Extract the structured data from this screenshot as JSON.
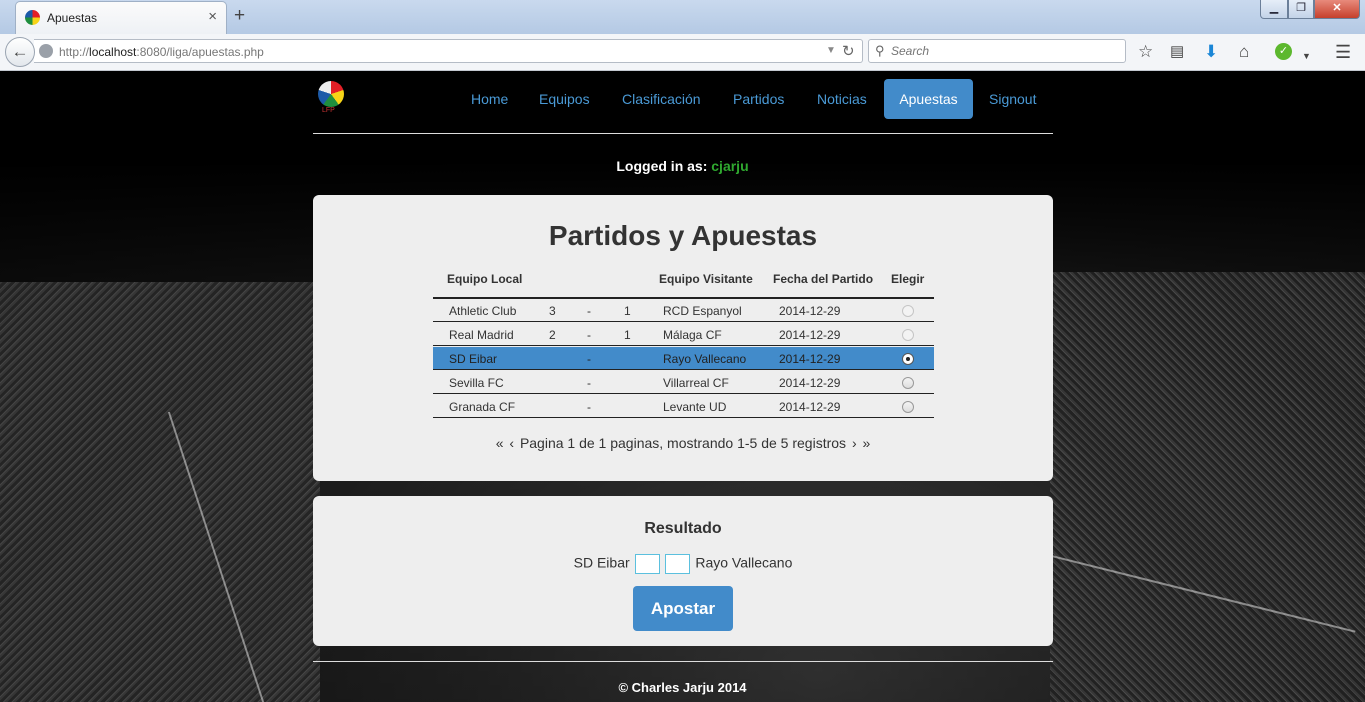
{
  "browser": {
    "tab_title": "Apuestas",
    "tab_close": "×",
    "new_tab": "+",
    "url_prefix": "http://",
    "url_host": "localhost",
    "url_rest": ":8080/liga/apuestas.php",
    "search_placeholder": "Search",
    "window_buttons": {
      "min": "▁",
      "max": "❐",
      "close": "✕"
    },
    "icons": [
      "bookmark-star-icon",
      "reading-list-icon",
      "download-icon",
      "home-icon",
      "addon-check-icon",
      "menu-icon"
    ]
  },
  "site": {
    "logo_text": "LFP",
    "nav": [
      {
        "label": "Home",
        "active": false
      },
      {
        "label": "Equipos",
        "active": false
      },
      {
        "label": "Clasificación",
        "active": false
      },
      {
        "label": "Partidos",
        "active": false
      },
      {
        "label": "Noticias",
        "active": false
      },
      {
        "label": "Apuestas",
        "active": true
      },
      {
        "label": "Signout",
        "active": false
      }
    ],
    "logged_in_label": "Logged in as:",
    "username": "cjarju"
  },
  "matches": {
    "title": "Partidos y Apuestas",
    "headers": [
      "Equipo Local",
      "Equipo Visitante",
      "Fecha del Partido",
      "Elegir"
    ],
    "rows": [
      {
        "local": "Athletic Club",
        "local_goals": "3",
        "sep": "-",
        "away_goals": "1",
        "away": "RCD Espanyol",
        "date": "2014-12-29",
        "selected": false,
        "disabled": true
      },
      {
        "local": "Real Madrid",
        "local_goals": "2",
        "sep": "-",
        "away_goals": "1",
        "away": "Málaga CF",
        "date": "2014-12-29",
        "selected": false,
        "disabled": true
      },
      {
        "local": "SD Eibar",
        "local_goals": "",
        "sep": "-",
        "away_goals": "",
        "away": "Rayo Vallecano",
        "date": "2014-12-29",
        "selected": true,
        "disabled": false
      },
      {
        "local": "Sevilla FC",
        "local_goals": "",
        "sep": "-",
        "away_goals": "",
        "away": "Villarreal CF",
        "date": "2014-12-29",
        "selected": false,
        "disabled": false
      },
      {
        "local": "Granada CF",
        "local_goals": "",
        "sep": "-",
        "away_goals": "",
        "away": "Levante UD",
        "date": "2014-12-29",
        "selected": false,
        "disabled": false
      }
    ],
    "pager": {
      "first": "«",
      "prev": "‹",
      "text": "Pagina 1 de 1 paginas, mostrando 1-5 de 5 registros",
      "next": "›",
      "last": "»"
    }
  },
  "result": {
    "title": "Resultado",
    "home_team": "SD Eibar",
    "away_team": "Rayo Vallecano",
    "home_score": "",
    "away_score": "",
    "button_label": "Apostar"
  },
  "footer": {
    "text": "© Charles Jarju 2014"
  }
}
